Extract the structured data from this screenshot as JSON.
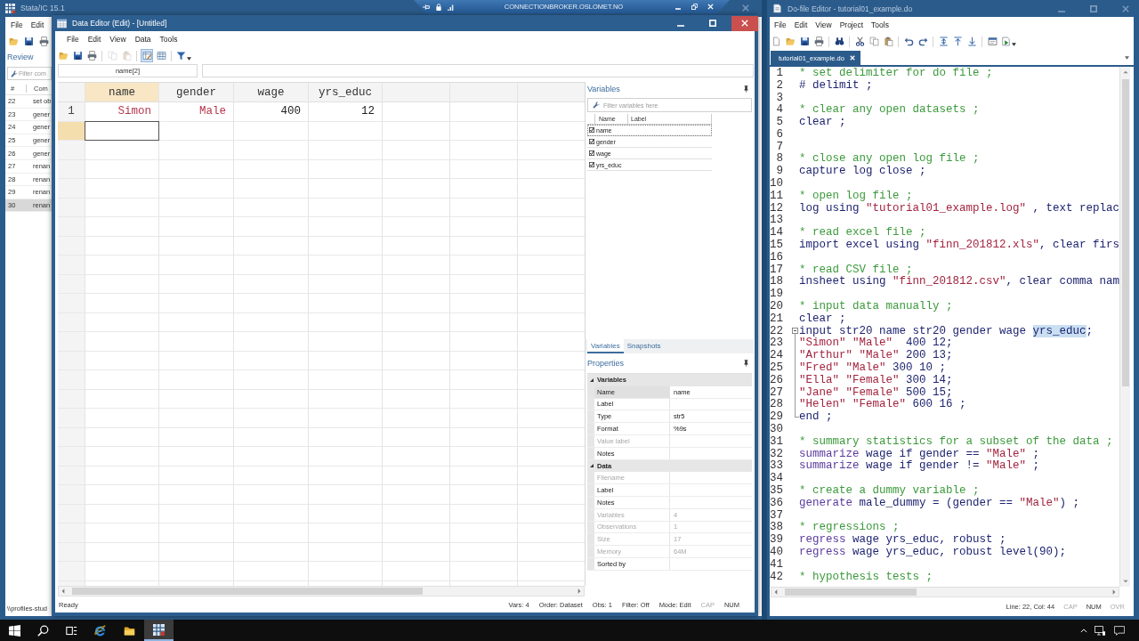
{
  "stata_window": {
    "title": "Stata/IC 15.1",
    "menu": [
      "File",
      "Edit"
    ],
    "toolbar": [
      {
        "kind": "open"
      },
      {
        "kind": "save"
      },
      {
        "kind": "print"
      }
    ],
    "review": {
      "title": "Review",
      "filter": {
        "placeholder": "Filter com"
      },
      "columns": [
        "#",
        "Com"
      ],
      "rows": [
        {
          "number": "22",
          "command": "set ob",
          "selected": false
        },
        {
          "number": "23",
          "command": "gener",
          "selected": false
        },
        {
          "number": "24",
          "command": "gener",
          "selected": false
        },
        {
          "number": "25",
          "command": "gener",
          "selected": false
        },
        {
          "number": "26",
          "command": "gener",
          "selected": false
        },
        {
          "number": "27",
          "command": "renan",
          "selected": false
        },
        {
          "number": "28",
          "command": "renan",
          "selected": false
        },
        {
          "number": "29",
          "command": "renan",
          "selected": false
        },
        {
          "number": "30",
          "command": "renan",
          "selected": true
        }
      ]
    },
    "status_bar": "\\\\profiles-stud"
  },
  "remote_bar": {
    "host": "CONNECTIONBROKER.OSLOMET.NO"
  },
  "data_editor": {
    "title": "Data Editor (Edit) - [Untitled]",
    "menu": [
      "File",
      "Edit",
      "View",
      "Data",
      "Tools"
    ],
    "toolbar": [
      {
        "kind": "open",
        "disabled": false,
        "pressed": false
      },
      {
        "kind": "save",
        "disabled": false,
        "pressed": false
      },
      {
        "kind": "print",
        "disabled": false,
        "pressed": false
      },
      {
        "kind": "copy",
        "disabled": true,
        "pressed": false
      },
      {
        "kind": "paste",
        "disabled": true,
        "pressed": false
      },
      {
        "kind": "edit-mode",
        "disabled": false,
        "pressed": true
      },
      {
        "kind": "browse-mode",
        "disabled": false,
        "pressed": false
      },
      {
        "kind": "filter",
        "disabled": false,
        "pressed": false
      }
    ],
    "cell_name": "name[2]",
    "grid": {
      "columns": [
        {
          "label": "name",
          "selected": true
        },
        {
          "label": "gender",
          "selected": false
        },
        {
          "label": "wage",
          "selected": false
        },
        {
          "label": "yrs_educ",
          "selected": false
        }
      ],
      "rows": [
        {
          "number": "1",
          "selected": false,
          "cells": [
            {
              "value": "Simon",
              "kind": "string"
            },
            {
              "value": "Male",
              "kind": "string"
            },
            {
              "value": "400",
              "kind": "numeric"
            },
            {
              "value": "12",
              "kind": "numeric"
            }
          ]
        },
        {
          "selected": true
        }
      ]
    },
    "variables": {
      "title": "Variables",
      "filter": {
        "placeholder": "Filter variables here"
      },
      "columns": [
        "Name",
        "Label"
      ],
      "items": [
        {
          "name": "name",
          "checked": true,
          "selected": true
        },
        {
          "name": "gender",
          "checked": true,
          "selected": false
        },
        {
          "name": "wage",
          "checked": true,
          "selected": false
        },
        {
          "name": "yrs_educ",
          "checked": true,
          "selected": false
        }
      ],
      "tabs": [
        {
          "label": "Variables",
          "selected": true
        },
        {
          "label": "Snapshots",
          "selected": false
        }
      ]
    },
    "properties": {
      "title": "Properties",
      "sections": [
        {
          "title": "Variables",
          "expanded": true,
          "rows": [
            {
              "label": "Name",
              "value": "name",
              "disabled": false,
              "selected": true
            },
            {
              "label": "Label",
              "disabled": false,
              "selected": false
            },
            {
              "label": "Type",
              "value": "str5",
              "disabled": false,
              "selected": false
            },
            {
              "label": "Format",
              "value": "%9s",
              "disabled": false,
              "selected": false
            },
            {
              "label": "Value label",
              "disabled": true,
              "selected": false
            },
            {
              "label": "Notes",
              "disabled": false,
              "selected": false
            }
          ]
        },
        {
          "title": "Data",
          "expanded": true,
          "rows": [
            {
              "label": "Filename",
              "disabled": true,
              "selected": false
            },
            {
              "label": "Label",
              "disabled": false,
              "selected": false
            },
            {
              "label": "Notes",
              "disabled": false,
              "selected": false
            },
            {
              "label": "Variables",
              "value": "4",
              "disabled": true,
              "selected": false
            },
            {
              "label": "Observations",
              "value": "1",
              "disabled": true,
              "selected": false
            },
            {
              "label": "Size",
              "value": "17",
              "disabled": true,
              "selected": false
            },
            {
              "label": "Memory",
              "value": "64M",
              "disabled": true,
              "selected": false
            },
            {
              "label": "Sorted by",
              "disabled": false,
              "selected": false
            }
          ]
        }
      ]
    },
    "status_bar": {
      "message": "Ready",
      "items": [
        {
          "text": "Vars: 4",
          "disabled": false
        },
        {
          "text": "Order: Dataset",
          "disabled": false
        },
        {
          "text": "Obs: 1",
          "disabled": false
        },
        {
          "text": "Filter: Off",
          "disabled": false
        },
        {
          "text": "Mode: Edit",
          "disabled": false
        },
        {
          "text": "CAP",
          "disabled": true
        },
        {
          "text": "NUM",
          "disabled": false
        }
      ]
    }
  },
  "do_file_editor": {
    "title": "Do-file Editor - tutorial01_example.do",
    "menu": [
      "File",
      "Edit",
      "View",
      "Project",
      "Tools"
    ],
    "toolbar": [
      {
        "kind": "new"
      },
      {
        "kind": "open"
      },
      {
        "kind": "save"
      },
      {
        "kind": "print"
      },
      {
        "kind": "find"
      },
      {
        "kind": "cut"
      },
      {
        "kind": "copy"
      },
      {
        "kind": "paste"
      },
      {
        "kind": "undo"
      },
      {
        "kind": "redo"
      },
      {
        "kind": "bookmark-toggle"
      },
      {
        "kind": "bookmark-previous"
      },
      {
        "kind": "bookmark-next"
      },
      {
        "kind": "show-file"
      },
      {
        "kind": "execute"
      }
    ],
    "tabs": [
      {
        "label": "tutorial01_example.do",
        "selected": true
      }
    ],
    "lines": [
      {
        "number": "1",
        "segments": [
          {
            "kind": "comment",
            "text": "* set delimiter for do file ;"
          }
        ]
      },
      {
        "number": "2",
        "segments": [
          {
            "kind": "plain",
            "text": "# delimit ;"
          }
        ]
      },
      {
        "number": "3"
      },
      {
        "number": "4",
        "segments": [
          {
            "kind": "comment",
            "text": "* clear any open datasets ;"
          }
        ]
      },
      {
        "number": "5",
        "segments": [
          {
            "kind": "plain",
            "text": "clear ;"
          }
        ]
      },
      {
        "number": "6"
      },
      {
        "number": "7"
      },
      {
        "number": "8",
        "segments": [
          {
            "kind": "comment",
            "text": "* close any open log file ;"
          }
        ]
      },
      {
        "number": "9",
        "segments": [
          {
            "kind": "plain",
            "text": "capture log close ;"
          }
        ]
      },
      {
        "number": "10"
      },
      {
        "number": "11",
        "segments": [
          {
            "kind": "comment",
            "text": "* open log file ;"
          }
        ]
      },
      {
        "number": "12",
        "segments": [
          {
            "kind": "plain",
            "text": "log using "
          },
          {
            "kind": "string",
            "text": "\"tutorial01_example.log\""
          },
          {
            "kind": "plain",
            "text": " , text replac"
          }
        ]
      },
      {
        "number": "13"
      },
      {
        "number": "14",
        "segments": [
          {
            "kind": "comment",
            "text": "* read excel file ;"
          }
        ]
      },
      {
        "number": "15",
        "segments": [
          {
            "kind": "plain",
            "text": "import excel using "
          },
          {
            "kind": "string",
            "text": "\"finn_201812.xls\""
          },
          {
            "kind": "plain",
            "text": ", clear firs"
          }
        ]
      },
      {
        "number": "16"
      },
      {
        "number": "17",
        "segments": [
          {
            "kind": "comment",
            "text": "* read CSV file ;"
          }
        ]
      },
      {
        "number": "18",
        "segments": [
          {
            "kind": "plain",
            "text": "insheet using "
          },
          {
            "kind": "string",
            "text": "\"finn_201812.csv\""
          },
          {
            "kind": "plain",
            "text": ", clear comma nam"
          }
        ]
      },
      {
        "number": "19"
      },
      {
        "number": "20",
        "segments": [
          {
            "kind": "comment",
            "text": "* input data manually ;"
          }
        ]
      },
      {
        "number": "21",
        "segments": [
          {
            "kind": "plain",
            "text": "clear ;"
          }
        ]
      },
      {
        "number": "22",
        "expanded": true,
        "segments": [
          {
            "kind": "plain",
            "text": "input str20 name str20 gender wage "
          },
          {
            "kind": "selection",
            "text": "yrs_educ"
          },
          {
            "kind": "plain",
            "text": ";"
          }
        ],
        "children": [
          {
            "number": "23",
            "segments": [
              {
                "kind": "string",
                "text": "\"Simon\""
              },
              {
                "kind": "string",
                "text": " \"Male\""
              },
              {
                "kind": "plain",
                "text": "  400 12;"
              }
            ]
          },
          {
            "number": "24",
            "segments": [
              {
                "kind": "string",
                "text": "\"Arthur\""
              },
              {
                "kind": "string",
                "text": " \"Male\""
              },
              {
                "kind": "plain",
                "text": " 200 13;"
              }
            ]
          },
          {
            "number": "25",
            "segments": [
              {
                "kind": "string",
                "text": "\"Fred\""
              },
              {
                "kind": "string",
                "text": " \"Male\""
              },
              {
                "kind": "plain",
                "text": " 300 10 ;"
              }
            ]
          },
          {
            "number": "26",
            "segments": [
              {
                "kind": "string",
                "text": "\"Ella\""
              },
              {
                "kind": "string",
                "text": " \"Female\""
              },
              {
                "kind": "plain",
                "text": " 300 14;"
              }
            ]
          },
          {
            "number": "27",
            "segments": [
              {
                "kind": "string",
                "text": "\"Jane\""
              },
              {
                "kind": "string",
                "text": " \"Female\""
              },
              {
                "kind": "plain",
                "text": " 500 15;"
              }
            ]
          },
          {
            "number": "28",
            "segments": [
              {
                "kind": "string",
                "text": "\"Helen\""
              },
              {
                "kind": "string",
                "text": " \"Female\""
              },
              {
                "kind": "plain",
                "text": " 600 16 ;"
              }
            ]
          },
          {
            "number": "29",
            "segments": [
              {
                "kind": "plain",
                "text": "end ;"
              }
            ]
          }
        ]
      },
      {
        "number": "30"
      },
      {
        "number": "31",
        "segments": [
          {
            "kind": "comment",
            "text": "* summary statistics for a subset of the data ;"
          }
        ]
      },
      {
        "number": "32",
        "segments": [
          {
            "kind": "command",
            "text": "summarize"
          },
          {
            "kind": "plain",
            "text": " wage if gender == "
          },
          {
            "kind": "string",
            "text": "\"Male\""
          },
          {
            "kind": "plain",
            "text": " ;"
          }
        ]
      },
      {
        "number": "33",
        "segments": [
          {
            "kind": "command",
            "text": "summarize"
          },
          {
            "kind": "plain",
            "text": " wage if gender != "
          },
          {
            "kind": "string",
            "text": "\"Male\""
          },
          {
            "kind": "plain",
            "text": " ;"
          }
        ]
      },
      {
        "number": "34"
      },
      {
        "number": "35",
        "segments": [
          {
            "kind": "comment",
            "text": "* create a dummy variable ;"
          }
        ]
      },
      {
        "number": "36",
        "segments": [
          {
            "kind": "command",
            "text": "generate"
          },
          {
            "kind": "plain",
            "text": " male_dummy = (gender == "
          },
          {
            "kind": "string",
            "text": "\"Male\""
          },
          {
            "kind": "plain",
            "text": ") ;"
          }
        ]
      },
      {
        "number": "37"
      },
      {
        "number": "38",
        "segments": [
          {
            "kind": "comment",
            "text": "* regressions ;"
          }
        ]
      },
      {
        "number": "39",
        "segments": [
          {
            "kind": "command",
            "text": "regress"
          },
          {
            "kind": "plain",
            "text": " wage yrs_educ, robust ;"
          }
        ]
      },
      {
        "number": "40",
        "segments": [
          {
            "kind": "command",
            "text": "regress"
          },
          {
            "kind": "plain",
            "text": " wage yrs_educ, robust level(90);"
          }
        ]
      },
      {
        "number": "41"
      },
      {
        "number": "42",
        "segments": [
          {
            "kind": "comment",
            "text": "* hypothesis tests ;"
          }
        ]
      }
    ],
    "status_bar": {
      "position": "Line: 22, Col: 44",
      "indicators": [
        {
          "text": "CAP",
          "disabled": true
        },
        {
          "text": "NUM",
          "disabled": false
        },
        {
          "text": "OVR",
          "disabled": true
        }
      ]
    }
  },
  "taskbar": {
    "apps": [
      {
        "kind": "browser",
        "active": false
      },
      {
        "kind": "folder",
        "active": false
      },
      {
        "kind": "stata",
        "active": true
      }
    ]
  }
}
